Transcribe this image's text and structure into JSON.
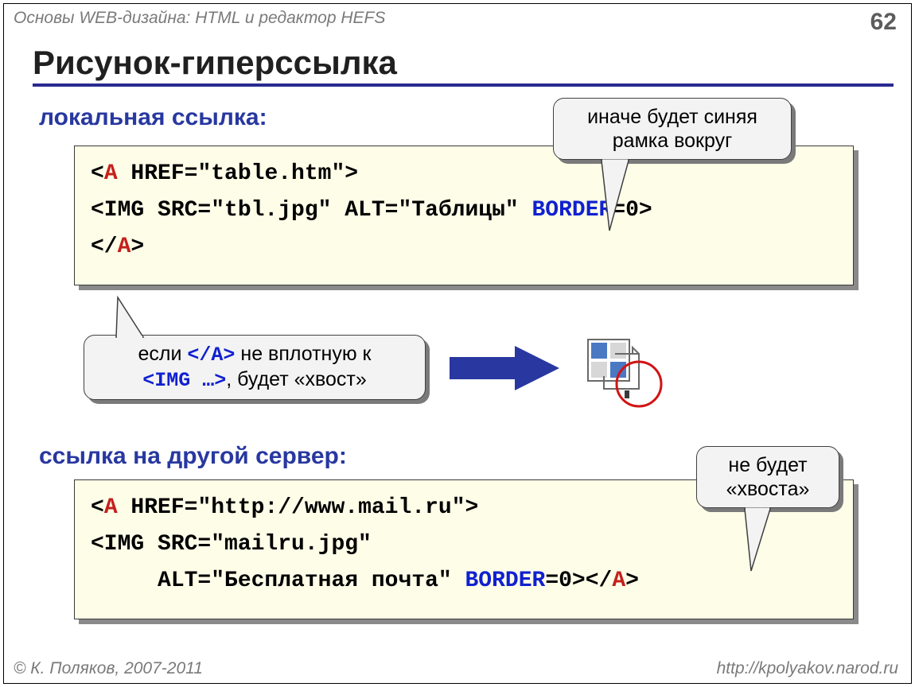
{
  "header": {
    "breadcrumb": "Основы WEB-дизайна: HTML и редактор HEFS",
    "page": "62"
  },
  "title": "Рисунок-гиперссылка",
  "sections": {
    "local": "локальная ссылка:",
    "remote": "ссылка на другой сервер:"
  },
  "code1": {
    "l1a": "<",
    "l1b": "A",
    "l1c": " HREF=\"table.htm\">",
    "l2": "<IMG SRC=\"tbl.jpg\" ALT=\"Таблицы\" ",
    "l2b": "BORDER",
    "l2c": "=0>",
    "l3a": "</",
    "l3b": "A",
    "l3c": ">"
  },
  "code2": {
    "l1a": "<",
    "l1b": "A",
    "l1c": " HREF=\"http://www.mail.ru\">",
    "l2": "<IMG SRC=\"mailru.jpg\"",
    "l3a": "     ALT=\"Бесплатная почта\" ",
    "l3b": "BORDER",
    "l3c": "=0>",
    "l3d": "</",
    "l3e": "A",
    "l3f": ">"
  },
  "callouts": {
    "c1a": "иначе будет синяя",
    "c1b": "рамка вокруг",
    "c2a": "если ",
    "c2b": "</A>",
    "c2c": " не вплотную к",
    "c2d": "<IMG …>",
    "c2e": ", будет «хвост»",
    "c3a": "не будет",
    "c3b": "«хвоста»"
  },
  "footer": {
    "left": "© К. Поляков, 2007-2011",
    "right": "http://kpolyakov.narod.ru"
  }
}
